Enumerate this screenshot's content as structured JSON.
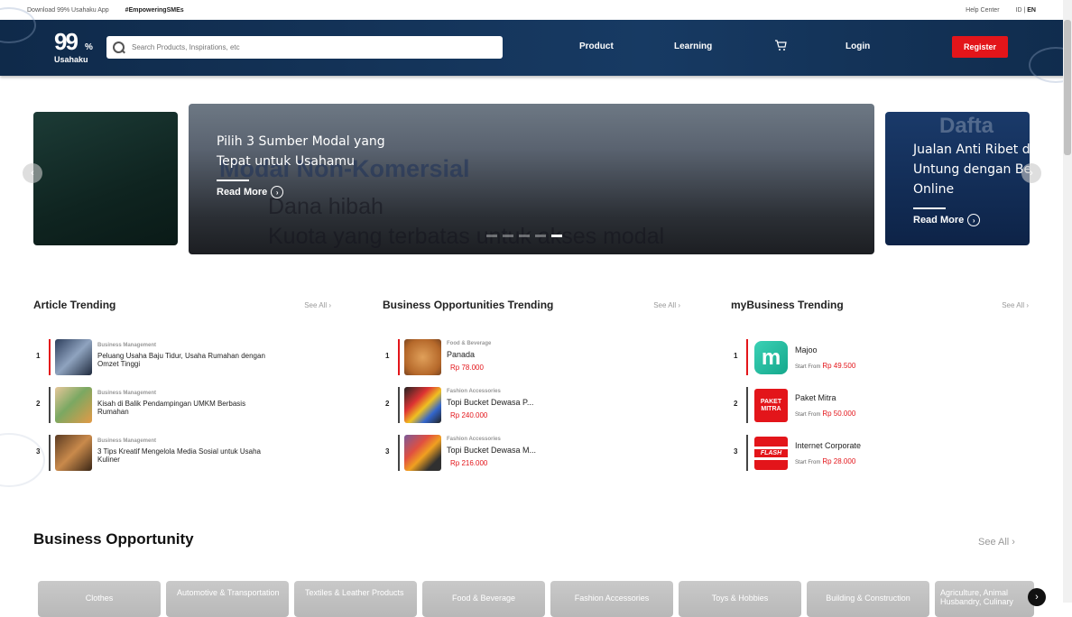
{
  "topbar": {
    "download": "Download 99% Usahaku App",
    "tag": "#EmpoweringSMEs",
    "help": "Help Center",
    "lang_id": "ID",
    "lang_sep": "|",
    "lang_en": "EN"
  },
  "header": {
    "logo_num": "99",
    "logo_pct": "%",
    "logo_name": "Usahaku",
    "search_placeholder": "Search Products, Inspirations, etc",
    "nav_product": "Product",
    "nav_learning": "Learning",
    "nav_login": "Login",
    "register": "Register",
    "cart_icon": "cart-icon"
  },
  "carousel": {
    "main_title_1": "Pilih 3 Sumber Modal yang",
    "main_title_2": "Tepat untuk Usahamu",
    "main_bg_1": "Modal Non-Komersial",
    "main_bg_2": "Dana hibah",
    "main_bg_3": "Kuota yang terbatas untuk akses modal",
    "read_more": "Read More",
    "right_title_1": "Jualan Anti Ribet da",
    "right_title_2": "Untung dengan Ber",
    "right_title_3": "Online",
    "right_bg": "Dafta",
    "right_read_more": "Read More"
  },
  "articles": {
    "title": "Article Trending",
    "see_all": "See All",
    "items": [
      {
        "rank": "1",
        "cat": "Business Management",
        "title": "Peluang Usaha Baju Tidur, Usaha Rumahan dengan Omzet Tinggi"
      },
      {
        "rank": "2",
        "cat": "Business Management",
        "title": "Kisah di Balik Pendampingan UMKM Berbasis Rumahan"
      },
      {
        "rank": "3",
        "cat": "Business Management",
        "title": "3 Tips Kreatif Mengelola Media Sosial untuk Usaha Kuliner"
      }
    ]
  },
  "opportunities": {
    "title": "Business Opportunities Trending",
    "see_all": "See All",
    "items": [
      {
        "rank": "1",
        "cat": "Food & Beverage",
        "title": "Panada",
        "price": "Rp 78.000"
      },
      {
        "rank": "2",
        "cat": "Fashion Accessories",
        "title": "Topi Bucket Dewasa P...",
        "price": "Rp 240.000"
      },
      {
        "rank": "3",
        "cat": "Fashion Accessories",
        "title": "Topi Bucket Dewasa M...",
        "price": "Rp 216.000"
      }
    ]
  },
  "mybusiness": {
    "title": "myBusiness Trending",
    "see_all": "See All",
    "start_from": "Start From",
    "items": [
      {
        "rank": "1",
        "name": "Majoo",
        "price": "Rp 49.500",
        "logo": "m"
      },
      {
        "rank": "2",
        "name": "Paket Mitra",
        "price": "Rp 50.000",
        "logo": "PAKET MITRA"
      },
      {
        "rank": "3",
        "name": "Internet Corporate",
        "price": "Rp 28.000",
        "logo": "FLASH"
      }
    ]
  },
  "business_opportunity": {
    "title": "Business Opportunity",
    "see_all": "See All",
    "categories": [
      "Clothes",
      "Automotive & Transportation",
      "Textiles & Leather Products",
      "Food & Beverage",
      "Fashion Accessories",
      "Toys & Hobbies",
      "Building & Construction",
      "Agriculture, Animal Husbandry, Culinary"
    ]
  },
  "colors": {
    "brand_red": "#e3151a",
    "header_navy": "#173a63"
  }
}
